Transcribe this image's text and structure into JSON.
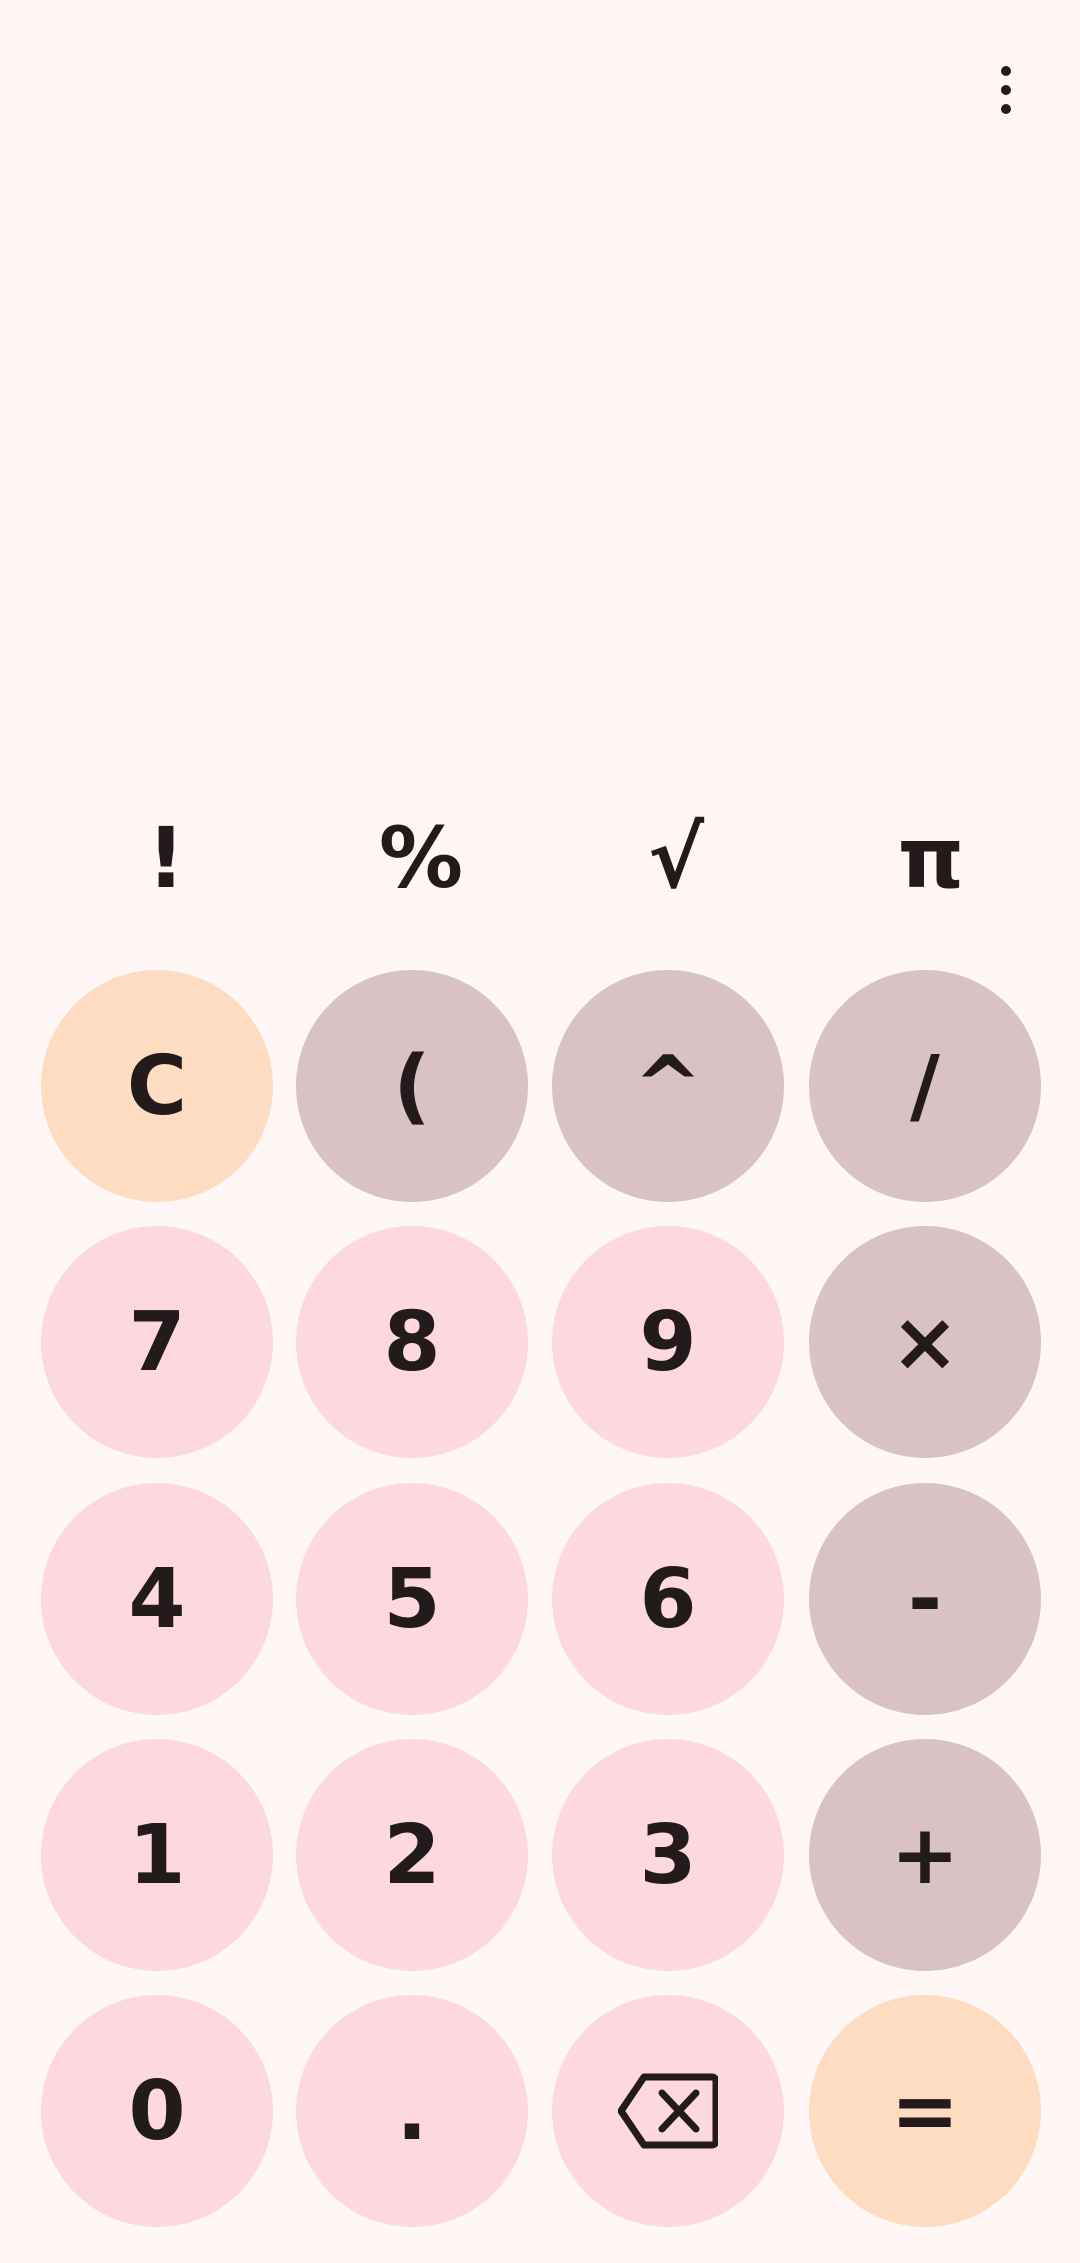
{
  "display": {
    "expression": "",
    "result": ""
  },
  "scientific_row": [
    {
      "name": "factorial-key",
      "label": "!"
    },
    {
      "name": "percent-key",
      "label": "%"
    },
    {
      "name": "square-root-key",
      "label": "√"
    },
    {
      "name": "pi-key",
      "label": "π"
    }
  ],
  "keypad": {
    "clear": "C",
    "paren": "(",
    "power": "^",
    "divide": "/",
    "seven": "7",
    "eight": "8",
    "nine": "9",
    "multiply": "×",
    "four": "4",
    "five": "5",
    "six": "6",
    "subtract": "-",
    "one": "1",
    "two": "2",
    "three": "3",
    "add": "+",
    "zero": "0",
    "decimal": ".",
    "equals": "="
  },
  "icons": {
    "menu": "more-vert-icon",
    "backspace": "backspace-icon"
  },
  "colors": {
    "background": "#fff7f5",
    "number_key": "#fdd8df",
    "operator_key": "#d8c2c4",
    "accent_key": "#fedcc1",
    "text": "#231a1c"
  }
}
